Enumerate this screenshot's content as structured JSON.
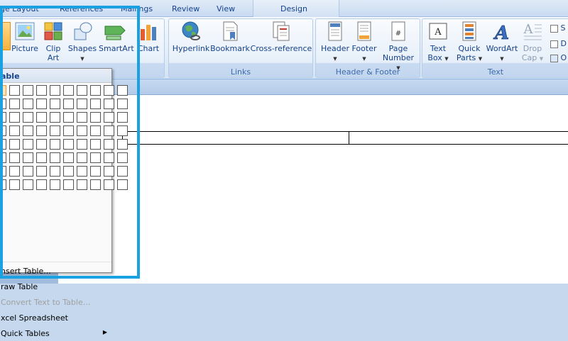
{
  "tabs": {
    "page_layout": "ge Layout",
    "references": "References",
    "mailings": "Mailings",
    "review": "Review",
    "view": "View",
    "design": "Design"
  },
  "illustrations": {
    "picture": "Picture",
    "clip_art_line1": "Clip",
    "clip_art_line2": "Art",
    "shapes": "Shapes",
    "smartart": "SmartArt",
    "chart": "Chart"
  },
  "links": {
    "hyperlink": "Hyperlink",
    "bookmark": "Bookmark",
    "cross_reference": "Cross-reference",
    "group_label": "Links"
  },
  "header_footer": {
    "header": "Header",
    "footer": "Footer",
    "page_number_line1": "Page",
    "page_number_line2": "Number",
    "group_label": "Header & Footer"
  },
  "text_group": {
    "text_box_line1": "Text",
    "text_box_line2": "Box",
    "quick_parts_line1": "Quick",
    "quick_parts_line2": "Parts",
    "wordart": "WordArt",
    "drop_cap_line1": "Drop",
    "drop_cap_line2": "Cap",
    "group_label": "Text",
    "small1": "S",
    "small2": "D",
    "small3": "O"
  },
  "dropdown": {
    "title": "able",
    "items": [
      {
        "label": "nsert Table...",
        "enabled": true
      },
      {
        "label": "raw Table",
        "enabled": true
      },
      {
        "label": "Convert Text to Table...",
        "enabled": false
      },
      {
        "label": "xcel Spreadsheet",
        "enabled": true
      },
      {
        "label": "Quick Tables",
        "enabled": true,
        "submenu": true
      }
    ]
  },
  "colors": {
    "highlight": "#1aa1e1",
    "grid_hover": "#f29436"
  }
}
